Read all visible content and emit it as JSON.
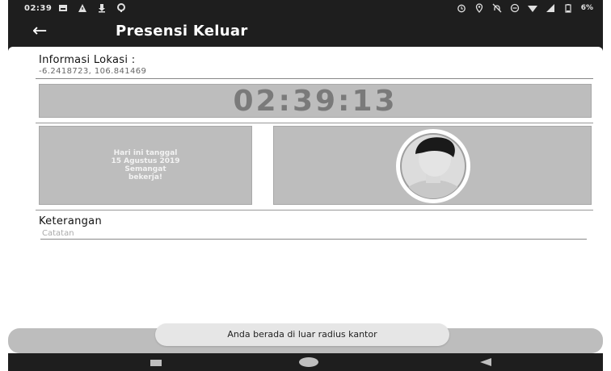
{
  "status_bar": {
    "time": "02:39",
    "battery": "6%",
    "left_icons": [
      "image-icon",
      "warning-icon",
      "download-icon",
      "wifi-alert-icon"
    ],
    "right_icons": [
      "alarm-icon",
      "location-icon",
      "dnd-icon",
      "minus-circle-icon",
      "wifi-icon",
      "signal-icon",
      "battery-icon"
    ]
  },
  "app_bar": {
    "back_icon": "arrow-left-icon",
    "title": "Presensi Keluar"
  },
  "location": {
    "label": "Informasi Lokasi :",
    "value": "-6.2418723, 106.841469"
  },
  "clock": {
    "time": "02:39:13"
  },
  "greeting": {
    "text": "Hari ini tanggal\n15 Agustus 2019\nSemangat\nbekerja!"
  },
  "photo": {
    "icon": "avatar-placeholder-icon"
  },
  "notes": {
    "label": "Keterangan",
    "placeholder": "Catatan"
  },
  "toast": {
    "text": "Anda berada di luar radius kantor"
  },
  "nav": {
    "icons": [
      "recent-apps-icon",
      "home-icon",
      "back-triangle-icon"
    ]
  },
  "colors": {
    "app_bar": "#1e1e1e",
    "panel_gray": "#bdbdbd",
    "clock_text": "#7a7a7a"
  }
}
